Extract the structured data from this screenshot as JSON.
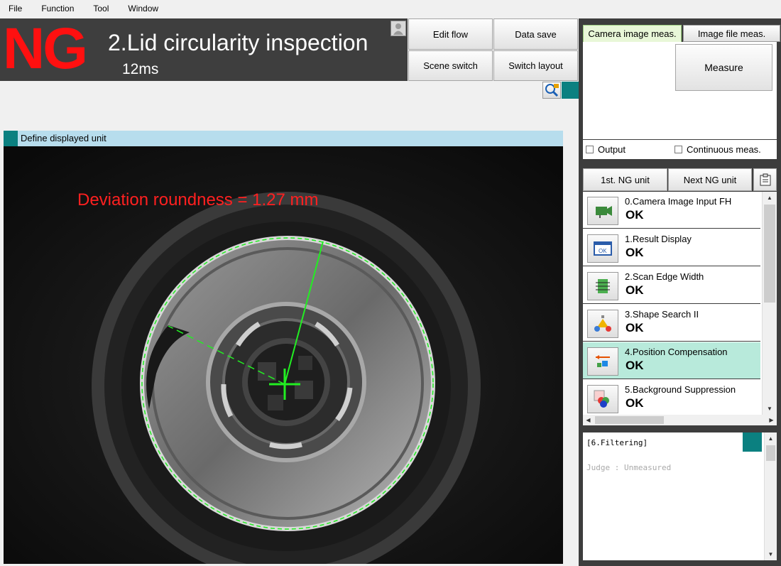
{
  "menu": {
    "items": [
      "File",
      "Function",
      "Tool",
      "Window"
    ]
  },
  "header": {
    "judgement": "NG",
    "scene_title": "2.Lid circularity inspection",
    "processing_time": "12ms"
  },
  "toolbar": {
    "edit_flow": "Edit flow",
    "data_save": "Data save",
    "scene_switch": "Scene switch",
    "switch_layout": "Switch layout"
  },
  "image_panel": {
    "title": "Define displayed unit",
    "overlay_text": "Deviation roundness =  1.27  mm"
  },
  "measure_panel": {
    "tabs": [
      "Camera image meas.",
      "Image file meas."
    ],
    "measure_button": "Measure",
    "output_label": "Output",
    "continuous_label": "Continuous meas."
  },
  "unit_nav": {
    "first_ng": "1st. NG unit",
    "next_ng": "Next NG unit"
  },
  "units": [
    {
      "name": "0.Camera Image Input FH",
      "result": "OK",
      "icon": "camera-icon"
    },
    {
      "name": "1.Result Display",
      "result": "OK",
      "icon": "ok-display-icon"
    },
    {
      "name": "2.Scan Edge Width",
      "result": "OK",
      "icon": "scan-edge-icon"
    },
    {
      "name": "3.Shape Search II",
      "result": "OK",
      "icon": "shape-search-icon"
    },
    {
      "name": "4.Position Compensation",
      "result": "OK",
      "icon": "position-compensation-icon"
    },
    {
      "name": "5.Background Suppression",
      "result": "OK",
      "icon": "background-suppression-icon"
    }
  ],
  "detail": {
    "title": "[6.Filtering]",
    "judge": "Judge : Unmeasured"
  },
  "colors": {
    "ng_red": "#ff1010",
    "teal": "#0b8080",
    "selected_row": "#b8eadb",
    "panel_bar": "#b7dded",
    "overlay_green": "#22ee22"
  }
}
